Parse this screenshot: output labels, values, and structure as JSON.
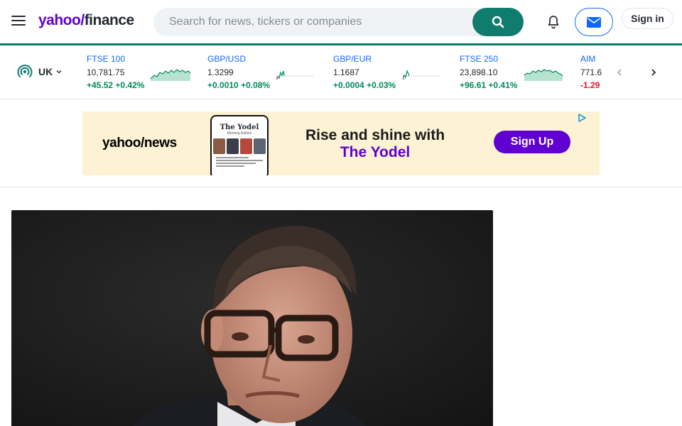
{
  "header": {
    "logo_yahoo": "yahoo/",
    "logo_finance": "finance",
    "search_placeholder": "Search for news, tickers or companies",
    "signin_label": "Sign in"
  },
  "region": {
    "label": "UK"
  },
  "tickers": [
    {
      "name": "FTSE 100",
      "price": "10,781.75",
      "change": "+45.52",
      "pct": "+0.42%",
      "dir": "up"
    },
    {
      "name": "GBP/USD",
      "price": "1.3299",
      "change": "+0.0010",
      "pct": "+0.08%",
      "dir": "up"
    },
    {
      "name": "GBP/EUR",
      "price": "1.1687",
      "change": "+0.0004",
      "pct": "+0.03%",
      "dir": "up"
    },
    {
      "name": "FTSE 250",
      "price": "23,898.10",
      "change": "+96.61",
      "pct": "+0.41%",
      "dir": "up"
    },
    {
      "name": "AIM",
      "price": "771.6",
      "change": "-1.29",
      "pct": "",
      "dir": "down"
    }
  ],
  "ad": {
    "brand": "yahoo/news",
    "phone_title": "The Yodel",
    "phone_subtitle": "Morning Edition",
    "headline_line1": "Rise and shine with",
    "headline_line2": "The Yodel",
    "cta": "Sign Up"
  },
  "colors": {
    "accent": "#0f7c6e",
    "brand_purple": "#6001d2",
    "positive": "#008a5e",
    "negative": "#eb0f29",
    "link_blue": "#0f69ff"
  },
  "icons": [
    "menu-icon",
    "search-icon",
    "bell-icon",
    "mail-icon",
    "signal-icon",
    "chevron-down-icon",
    "chevron-left-icon",
    "chevron-right-icon",
    "ad-choices-icon"
  ]
}
